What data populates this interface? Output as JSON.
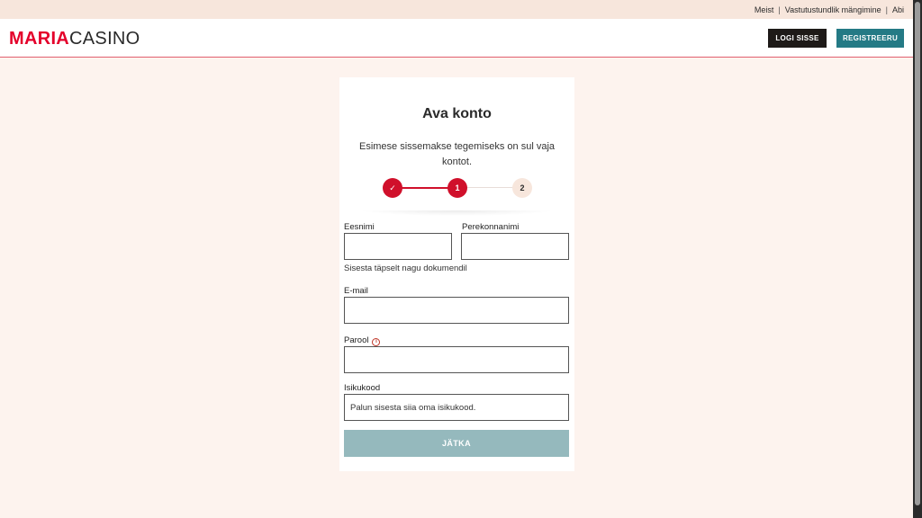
{
  "topbar": {
    "links": [
      "Meist",
      "Vastutustundlik mängimine",
      "Abi"
    ],
    "separator": "|"
  },
  "header": {
    "logo_part1": "MARIA",
    "logo_part2": "CASINO",
    "login_label": "LOGI SISSE",
    "register_label": "REGISTREERU"
  },
  "form": {
    "title": "Ava konto",
    "subtitle": "Esimese sissemakse tegemiseks on sul vaja kontot.",
    "steps": {
      "done_icon": "✓",
      "current": "1",
      "next": "2"
    },
    "first_name_label": "Eesnimi",
    "last_name_label": "Perekonnanimi",
    "name_hint": "Sisesta täpselt nagu dokumendil",
    "email_label": "E-mail",
    "password_label": "Parool",
    "password_info_icon": "i",
    "id_code_label": "Isikukood",
    "id_code_placeholder": "Palun sisesta siia oma isikukood.",
    "continue_label": "JÄTKA"
  },
  "colors": {
    "brand_red": "#e4002b",
    "step_red": "#d0102b",
    "teal": "#247a85",
    "continue_disabled": "#95b9bd",
    "page_bg": "#fdf3ee"
  }
}
